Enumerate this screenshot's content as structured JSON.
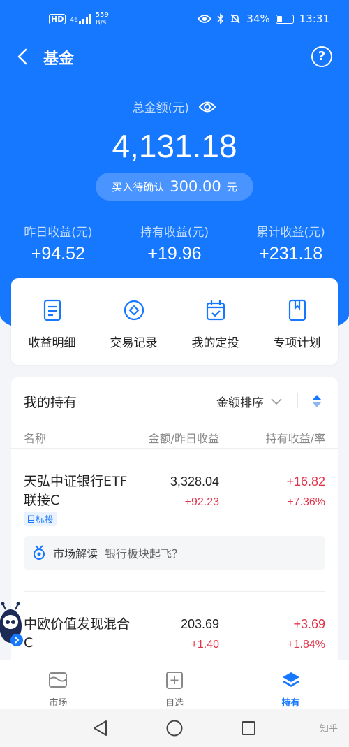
{
  "status_bar": {
    "network_badge": "HD",
    "signal": "46",
    "speed_value": "559",
    "speed_unit": "B/s",
    "battery": "34%",
    "time": "13:31",
    "battery_level": 0.34
  },
  "nav": {
    "title": "基金",
    "back_icon": "chevron-left-icon",
    "help_label": "?"
  },
  "summary": {
    "total_label": "总金额(元)",
    "total_amount": "4,131.18",
    "pending_label": "买入待确认",
    "pending_value": "300.00",
    "pending_unit": "元",
    "stats": [
      {
        "label": "昨日收益(元)",
        "value": "+94.52"
      },
      {
        "label": "持有收益(元)",
        "value": "+19.96"
      },
      {
        "label": "累计收益(元)",
        "value": "+231.18"
      }
    ]
  },
  "actions": [
    {
      "label": "收益明细",
      "icon": "document-icon"
    },
    {
      "label": "交易记录",
      "icon": "coin-icon"
    },
    {
      "label": "我的定投",
      "icon": "calendar-check-icon"
    },
    {
      "label": "专项计划",
      "icon": "bookmark-icon"
    }
  ],
  "holdings": {
    "title": "我的持有",
    "sort_label": "金额排序",
    "columns": {
      "name": "名称",
      "amount": "金额/昨日收益",
      "profit": "持有收益/率"
    },
    "funds": [
      {
        "name": "天弘中证银行ETF联接C",
        "amount": "3,328.04",
        "yesterday": "+92.23",
        "profit": "+16.82",
        "rate": "+7.36%",
        "tag": "目标投",
        "insight_label": "市场解读",
        "insight_text": "银行板块起飞？"
      },
      {
        "name": "中欧价值发现混合C",
        "amount": "203.69",
        "yesterday": "+1.40",
        "profit": "+3.69",
        "rate": "+1.84%"
      }
    ]
  },
  "tabs": [
    {
      "label": "市场",
      "icon": "market-icon",
      "active": false
    },
    {
      "label": "自选",
      "icon": "add-favorite-icon",
      "active": false
    },
    {
      "label": "持有",
      "icon": "layers-icon",
      "active": true
    }
  ],
  "watermark": "知乎",
  "colors": {
    "brand_blue": "#1677ff",
    "profit_red": "#e0344a"
  }
}
